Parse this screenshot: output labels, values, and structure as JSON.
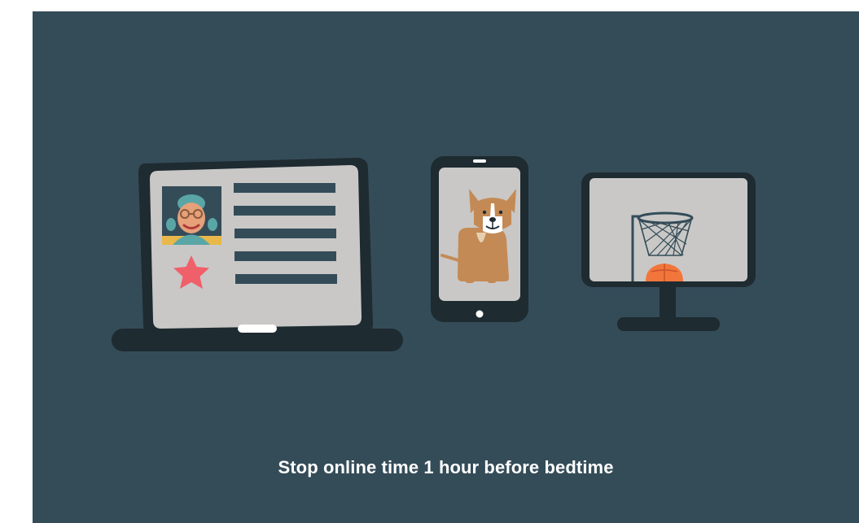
{
  "slide": {
    "caption": "Stop online time 1 hour before bedtime",
    "colors": {
      "background": "#344c58",
      "device_frame": "#1e2b31",
      "screen": "#c9c8c6",
      "text_lines": "#344c58",
      "star": "#f0606a",
      "dog": "#c48a55",
      "ball": "#f2763b",
      "caption": "#ffffff"
    },
    "illustration": {
      "laptop": {
        "profile_icon": "avatar-icon",
        "rating_icon": "star-icon"
      },
      "phone": {
        "image_icon": "dog-icon"
      },
      "monitor": {
        "image_icon": "basketball-hoop-icon"
      }
    }
  }
}
